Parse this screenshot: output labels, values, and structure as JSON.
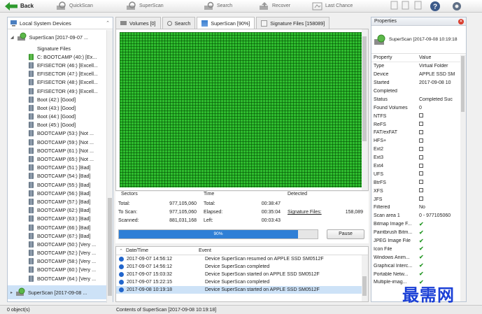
{
  "toolbar": {
    "back": "Back",
    "quickscan": "QuickScan",
    "superscan": "SuperScan",
    "search": "Search",
    "recover": "Recover",
    "last_chance": "Last Chance"
  },
  "left_panel": {
    "title": "Local System Devices",
    "root": "SuperScan [2017-09-07 ...",
    "items": [
      "Signature Files",
      "C: BOOTCAMP (40:) [Ex...",
      "EFISECTOR (46:) [Excell...",
      "EFISECTOR (47:) [Excell...",
      "EFISECTOR (48:) [Excell...",
      "EFISECTOR (49:) [Excell...",
      "Boot (42:) [Good]",
      "Boot (43:) [Good]",
      "Boot (44:) [Good]",
      "Boot (45:) [Good]",
      "BOOTCAMP (53:) [Not ...",
      "BOOTCAMP (59:) [Not ...",
      "BOOTCAMP (61:) [Not ...",
      "BOOTCAMP (65:) [Not ...",
      "BOOTCAMP (51:) [Bad]",
      "BOOTCAMP (54:) [Bad]",
      "BOOTCAMP (55:) [Bad]",
      "BOOTCAMP (56:) [Bad]",
      "BOOTCAMP (57:) [Bad]",
      "BOOTCAMP (62:) [Bad]",
      "BOOTCAMP (63:) [Bad]",
      "BOOTCAMP (66:) [Bad]",
      "BOOTCAMP (67:) [Bad]",
      "BOOTCAMP (50:) [Very ...",
      "BOOTCAMP (52:) [Very ...",
      "BOOTCAMP (58:) [Very ...",
      "BOOTCAMP (60:) [Very ...",
      "BOOTCAMP (64:) [Very ..."
    ],
    "root2": "SuperScan [2017-09-08 ..."
  },
  "tabs": [
    {
      "label": "Volumes [0]"
    },
    {
      "label": "Search"
    },
    {
      "label": "SuperScan [90%]"
    },
    {
      "label": "Signature Files [158089]"
    }
  ],
  "stats": {
    "col_sectors": "Sectors",
    "col_time": "Time",
    "col_detected": "Detected",
    "total_label": "Total:",
    "total_value": "977,105,060",
    "toscan_label": "To Scan:",
    "toscan_value": "977,105,060",
    "scanned_label": "Scanned:",
    "scanned_value": "881,031,168",
    "t_total_label": "Total:",
    "t_total_value": "00:38:47",
    "elapsed_label": "Elapsed:",
    "elapsed_value": "00:35:04",
    "left_label": "Left:",
    "left_value": "00:03:43",
    "sig_label": "Signature Files:",
    "sig_value": "158,089"
  },
  "progress": {
    "percent_text": "90%",
    "percent": 90,
    "pause": "Pause"
  },
  "log": {
    "col_datetime": "Date/Time",
    "col_event": "Event",
    "rows": [
      {
        "dt": "2017-09-07 14:56:12",
        "event": "Device SuperScan resumed on APPLE SSD SM0512F"
      },
      {
        "dt": "2017-09-07 14:56:12",
        "event": "Device SuperScan completed"
      },
      {
        "dt": "2017-09-07 15:03:32",
        "event": "Device SuperScan started on APPLE SSD SM0512F"
      },
      {
        "dt": "2017-09-07 15:22:15",
        "event": "Device SuperScan completed"
      },
      {
        "dt": "2017-09-08 10:19:18",
        "event": "Device SuperScan started on APPLE SSD SM0512F"
      }
    ]
  },
  "properties": {
    "title": "Properties",
    "header": "SuperScan [2017-09-08 10:19:18",
    "col_property": "Property",
    "col_value": "Value",
    "rows": [
      {
        "k": "Type",
        "v": "Virtual Folder"
      },
      {
        "k": "Device",
        "v": "APPLE SSD SM"
      },
      {
        "k": "Started",
        "v": "2017-09-08 10"
      },
      {
        "k": "Completed",
        "v": ""
      },
      {
        "k": "Status",
        "v": "Completed Suc"
      },
      {
        "k": "Found Volumes",
        "v": "0"
      }
    ],
    "fs_rows": [
      "NTFS",
      "ReFS",
      "FAT/exFAT",
      "HFS+",
      "Ext2",
      "Ext3",
      "Ext4",
      "UFS",
      "BtrFS",
      "XFS",
      "JFS"
    ],
    "filtered": {
      "k": "Filtered",
      "v": "No"
    },
    "scan_area": {
      "k": "Scan area 1",
      "v": "0 - 977105060"
    },
    "check_rows": [
      "Bitmap Image F...",
      "Paintbrush Bitm...",
      "JPEG Image File",
      "Icon File",
      "Windows Anim...",
      "Graphical Interc...",
      "Portable Netw...",
      "Multiple-imag..."
    ]
  },
  "status": {
    "objects": "0 object(s)",
    "contents": "Contents of SuperScan [2017-09-08 10:19:18]"
  },
  "watermark": "最需网"
}
